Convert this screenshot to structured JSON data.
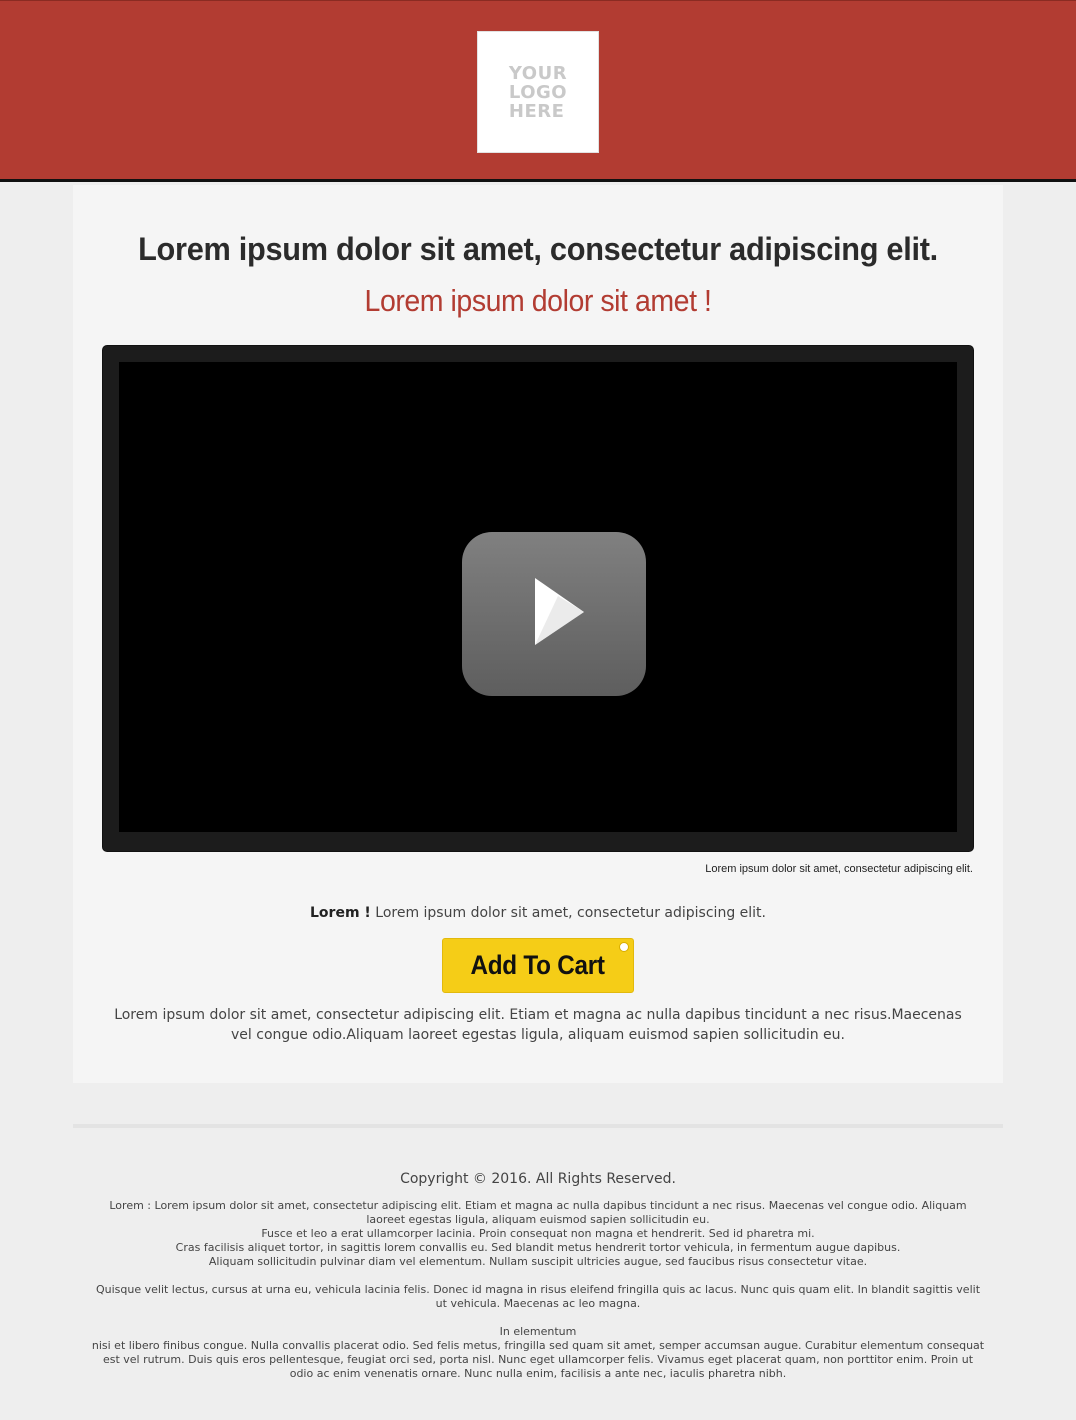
{
  "header": {
    "logo_text": "YOUR\nLOGO\nHERE",
    "brand_color": "#b23c32"
  },
  "main": {
    "headline": "Lorem ipsum dolor sit amet, consectetur adipiscing elit.",
    "subheadline": "Lorem ipsum dolor sit amet !",
    "video": {
      "icon": "play-icon",
      "caption": "Lorem ipsum dolor sit amet, consectetur adipiscing elit."
    },
    "cta": {
      "lead_bold": "Lorem !",
      "lead_text": " Lorem ipsum dolor sit amet, consectetur adipiscing elit.",
      "button_label": "Add To Cart",
      "button_color": "#f5cd17"
    },
    "body_text": "Lorem ipsum dolor sit amet, consectetur adipiscing elit. Etiam et magna ac nulla dapibus tincidunt a nec risus.Maecenas vel congue odio.Aliquam laoreet egestas ligula, aliquam euismod sapien sollicitudin eu."
  },
  "footer": {
    "copyright": "Copyright © 2016. All Rights Reserved.",
    "lines": [
      "Lorem : Lorem ipsum dolor sit amet, consectetur adipiscing elit. Etiam et magna ac nulla dapibus tincidunt a nec risus. Maecenas vel congue odio. Aliquam laoreet egestas ligula, aliquam euismod sapien sollicitudin eu.",
      "Fusce et leo a erat ullamcorper lacinia. Proin consequat non magna et hendrerit. Sed id pharetra mi.",
      "Cras facilisis aliquet tortor, in sagittis lorem convallis eu. Sed blandit metus hendrerit tortor vehicula, in fermentum augue dapibus.",
      "Aliquam sollicitudin pulvinar diam vel elementum. Nullam suscipit ultricies augue, sed faucibus risus consectetur vitae.",
      "Quisque velit lectus, cursus at urna eu, vehicula lacinia felis. Donec id magna in risus eleifend fringilla quis ac lacus. Nunc quis quam elit. In blandit sagittis velit ut vehicula. Maecenas ac leo magna.",
      "In elementum",
      "nisi et libero finibus congue. Nulla convallis placerat odio. Sed felis metus, fringilla sed quam sit amet, semper accumsan augue. Curabitur elementum consequat est vel rutrum. Duis quis eros pellentesque, feugiat orci sed, porta nisl. Nunc eget ullamcorper felis. Vivamus eget placerat quam, non porttitor enim. Proin ut odio ac enim venenatis ornare. Nunc nulla enim, facilisis a ante nec, iaculis pharetra nibh."
    ]
  }
}
